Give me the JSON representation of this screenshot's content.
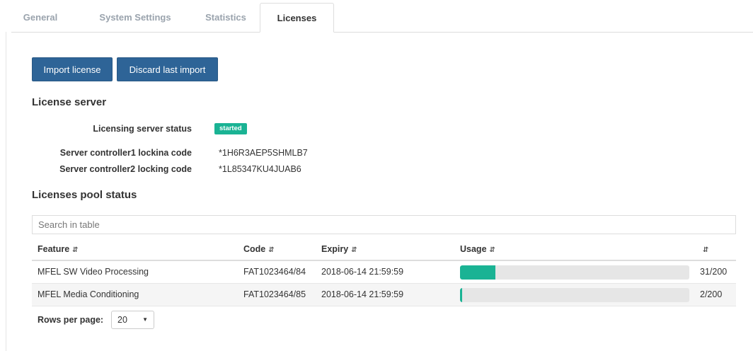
{
  "tabs": [
    {
      "label": "General",
      "active": false
    },
    {
      "label": "System Settings",
      "active": false
    },
    {
      "label": "Statistics",
      "active": false
    },
    {
      "label": "Licenses",
      "active": true
    }
  ],
  "toolbar": {
    "import_label": "Import license",
    "discard_label": "Discard last import"
  },
  "license_server": {
    "heading": "License server",
    "status_label": "Licensing server status",
    "status_value": "started",
    "controller1_label": "Server controller1 lockina code",
    "controller1_value": "*1H6R3AEP5SHMLB7",
    "controller2_label": "Server controller2 locking code",
    "controller2_value": "*1L85347KU4JUAB6"
  },
  "pool": {
    "heading": "Licenses pool status",
    "search_placeholder": "Search in table",
    "columns": [
      "Feature",
      "Code",
      "Expiry",
      "Usage",
      ""
    ],
    "sort_icon": "sort-icon",
    "rows": [
      {
        "feature": "MFEL SW Video Processing",
        "code": "FAT1023464/84",
        "expiry": "2018-06-14 21:59:59",
        "usage_fraction": 0.155,
        "usage_text": "31/200"
      },
      {
        "feature": "MFEL Media Conditioning",
        "code": "FAT1023464/85",
        "expiry": "2018-06-14 21:59:59",
        "usage_fraction": 0.01,
        "usage_text": "2/200"
      }
    ],
    "rows_per_page_label": "Rows per page:",
    "rows_per_page_value": "20"
  },
  "colors": {
    "primary_button": "#2e6497",
    "accent_green": "#1ab394",
    "bar_track": "#e6e6e6"
  }
}
